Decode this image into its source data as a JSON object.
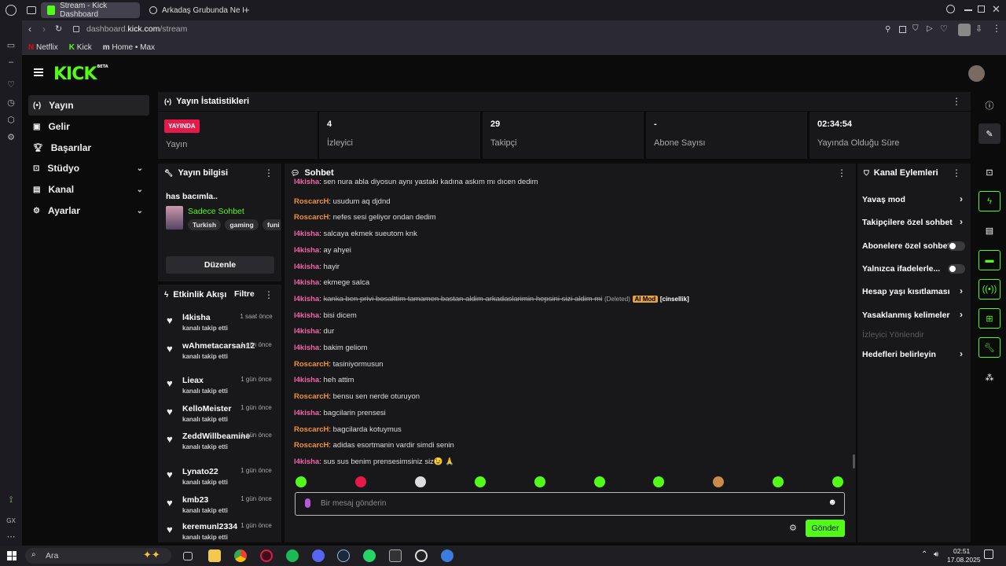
{
  "browser": {
    "tabs": [
      {
        "label": "Stream - Kick Dashboard"
      },
      {
        "label": "Arkadaş Grubunda Ne Ka"
      }
    ],
    "url_prefix": "dashboard.",
    "url_host": "kick.com",
    "url_path": "/stream",
    "bookmarks": [
      {
        "label": "Netflix"
      },
      {
        "label": "Kick"
      },
      {
        "label": "Home • Max"
      }
    ]
  },
  "header": {
    "logo": "KICK",
    "logo_beta": "BETA"
  },
  "sidebar": {
    "items": [
      {
        "label": "Yayın",
        "icon": "broadcast-icon"
      },
      {
        "label": "Gelir",
        "icon": "revenue-icon"
      },
      {
        "label": "Başarılar",
        "icon": "trophy-icon"
      },
      {
        "label": "Stüdyo",
        "icon": "studio-icon"
      },
      {
        "label": "Kanal",
        "icon": "channel-icon"
      },
      {
        "label": "Ayarlar",
        "icon": "settings-icon"
      }
    ]
  },
  "stats": {
    "title": "Yayın İstatistikleri",
    "live_badge": "YAYINDA",
    "live_label": "Yayın",
    "items": [
      {
        "value": "4",
        "label": "İzleyici"
      },
      {
        "value": "29",
        "label": "Takipçi"
      },
      {
        "value": "-",
        "label": "Abone Sayısı"
      },
      {
        "value": "02:34:54",
        "label": "Yayında Olduğu Süre"
      }
    ]
  },
  "stream_info": {
    "title": "Yayın bilgisi",
    "stream_title": "has bacımla..",
    "category": "Sadece Sohbet",
    "tags": [
      "Turkish",
      "gaming",
      "funi"
    ],
    "edit_button": "Düzenle"
  },
  "activity": {
    "title": "Etkinlik Akışı",
    "filter": "Filtre",
    "events": [
      {
        "name": "l4kisha",
        "sub": "kanalı takip etti",
        "time": "1 saat önce"
      },
      {
        "name": "wAhmetacarsan12",
        "sub": "kanalı takip etti",
        "time": "1 gün önce"
      },
      {
        "name": "Lieax",
        "sub": "kanalı takip etti",
        "time": "1 gün önce"
      },
      {
        "name": "KelloMeister",
        "sub": "kanalı takip etti",
        "time": "1 gün önce"
      },
      {
        "name": "ZeddWillbeamine",
        "sub": "kanalı takip etti",
        "time": "1 gün önce"
      },
      {
        "name": "Lynato22",
        "sub": "kanalı takip etti",
        "time": "1 gün önce"
      },
      {
        "name": "kmb23",
        "sub": "kanalı takip etti",
        "time": "1 gün önce"
      },
      {
        "name": "keremunl2334",
        "sub": "kanalı takip etti",
        "time": "1 gün önce"
      }
    ]
  },
  "chat": {
    "title": "Sohbet",
    "messages": [
      {
        "user": "l4kisha",
        "color": "pink",
        "text": "sen nura abla diyosun aynı yastakı kadına askım mı dıcen dedim"
      },
      {
        "user": "RoscarcH",
        "color": "orange",
        "text": "usudum aq djdnd"
      },
      {
        "user": "RoscarcH",
        "color": "orange",
        "text": "nefes sesi geliyor ondan dedim"
      },
      {
        "user": "l4kisha",
        "color": "pink",
        "text": "salcaya ekmek sueutom knk"
      },
      {
        "user": "l4kisha",
        "color": "pink",
        "text": "ay ahyei"
      },
      {
        "user": "l4kisha",
        "color": "pink",
        "text": "hayir"
      },
      {
        "user": "l4kisha",
        "color": "pink",
        "text": "ekmege salca"
      },
      {
        "user": "l4kisha",
        "color": "pink",
        "text": "kanka ben privi bosalttim tamamen bastan aldim arkadaslarimin hepsini sizi aldim mi",
        "deleted": "(Deleted)",
        "mod": "AI Mod",
        "reason": "[cinsellik]"
      },
      {
        "user": "l4kisha",
        "color": "pink",
        "text": "bisi dicem"
      },
      {
        "user": "l4kisha",
        "color": "pink",
        "text": "dur"
      },
      {
        "user": "l4kisha",
        "color": "pink",
        "text": "bakim geliom"
      },
      {
        "user": "RoscarcH",
        "color": "orange",
        "text": "tasiniyormusun"
      },
      {
        "user": "l4kisha",
        "color": "pink",
        "text": "heh attim"
      },
      {
        "user": "RoscarcH",
        "color": "orange",
        "text": "bensu sen nerde oturuyon"
      },
      {
        "user": "l4kisha",
        "color": "pink",
        "text": "bagcilarin prensesi"
      },
      {
        "user": "RoscarcH",
        "color": "orange",
        "text": "bagcilarda kotuymus"
      },
      {
        "user": "RoscarcH",
        "color": "orange",
        "text": "adidas esortmanin vardir simdi senin"
      },
      {
        "user": "l4kisha",
        "color": "pink",
        "text": "sus sus benim prensesimsiniz siz😉 🙏"
      }
    ],
    "input_placeholder": "Bir mesaj gönderin",
    "send_button": "Gönder"
  },
  "channel_actions": {
    "title": "Kanal Eylemleri",
    "items": [
      {
        "label": "Yavaş mod",
        "kind": "arrow"
      },
      {
        "label": "Takipçilere özel sohbet",
        "kind": "arrow"
      },
      {
        "label": "Abonelere özel sohbet",
        "kind": "toggle"
      },
      {
        "label": "Yalnızca ifadelerle...",
        "kind": "toggle"
      },
      {
        "label": "Hesap yaşı kısıtlaması",
        "kind": "arrow"
      },
      {
        "label": "Yasaklanmış kelimeler",
        "kind": "arrow"
      },
      {
        "label": "İzleyici Yönlendir",
        "kind": "disabled"
      },
      {
        "label": "Hedefleri belirleyin",
        "kind": "arrow"
      }
    ]
  },
  "taskbar": {
    "search": "Ara",
    "time": "02:51",
    "date": "17.08.2025"
  },
  "colors": {
    "accent": "#53fc18",
    "live": "#e5194a",
    "pink_user": "#f264a6",
    "orange_user": "#f29238"
  }
}
